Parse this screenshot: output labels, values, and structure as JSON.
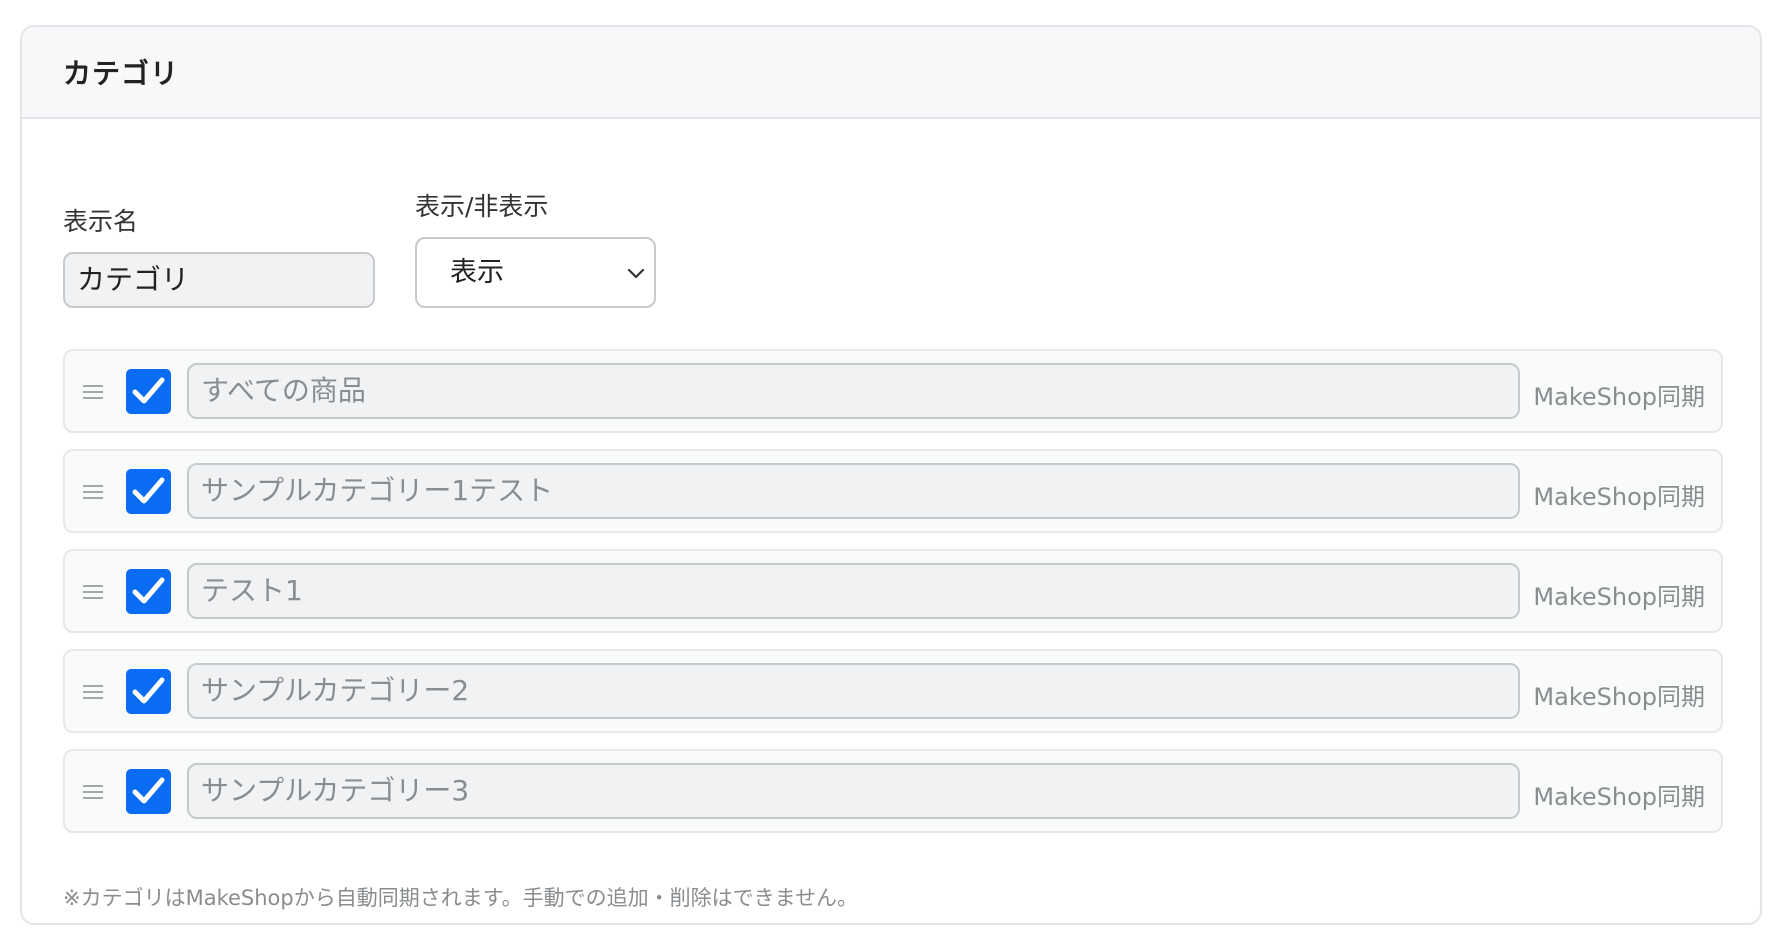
{
  "card": {
    "title": "カテゴリ"
  },
  "form": {
    "name_label": "表示名",
    "name_value": "カテゴリ",
    "visibility_label": "表示/非表示",
    "visibility_value": "表示"
  },
  "categories": [
    {
      "name": "すべての商品",
      "checked": true,
      "sync_label": "MakeShop同期"
    },
    {
      "name": "サンプルカテゴリー1テスト",
      "checked": true,
      "sync_label": "MakeShop同期"
    },
    {
      "name": "テスト1",
      "checked": true,
      "sync_label": "MakeShop同期"
    },
    {
      "name": "サンプルカテゴリー2",
      "checked": true,
      "sync_label": "MakeShop同期"
    },
    {
      "name": "サンプルカテゴリー3",
      "checked": true,
      "sync_label": "MakeShop同期"
    }
  ],
  "footnote": "※カテゴリはMakeShopから自動同期されます。手動での追加・削除はできません。",
  "colors": {
    "checkbox": "#0a6cf2",
    "muted_text": "#8a8d90",
    "border": "#e3e5e8"
  },
  "icons": {
    "drag": "drag-handle-icon",
    "check": "check-icon",
    "select": "chevron-down-icon"
  }
}
